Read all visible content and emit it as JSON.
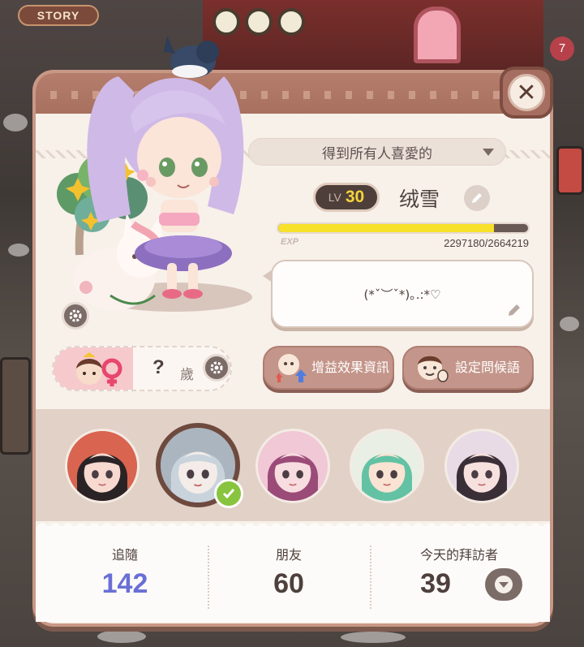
{
  "hud": {
    "story_label": "STORY",
    "notification_count": "7"
  },
  "profile": {
    "title_option": "得到所有人喜愛的",
    "level_prefix": "LV",
    "level": "30",
    "nickname": "绒雪",
    "exp_label": "EXP",
    "exp_text": "2297180/2664219",
    "exp_current": 2297180,
    "exp_max": 2664219,
    "greeting": "(*ˇ︶ˇ*)｡.:*♡",
    "age_value": "?",
    "age_unit": "歲"
  },
  "buttons": {
    "buff_effects": "增益效果資訊",
    "set_greeting": "設定問候語",
    "close_glyph": "✕"
  },
  "avatars": [
    {
      "name": "avatar-1",
      "selected": false,
      "hair": "#2a2326",
      "skin": "#f7d9cf",
      "bg": "#d9644f"
    },
    {
      "name": "avatar-2",
      "selected": true,
      "hair": "#c9d3dc",
      "skin": "#f3ece8",
      "bg": "#aab5bf"
    },
    {
      "name": "avatar-3",
      "selected": false,
      "hair": "#9b4b78",
      "skin": "#f8dde0",
      "bg": "#f1c8d6"
    },
    {
      "name": "avatar-4",
      "selected": false,
      "hair": "#63c2a4",
      "skin": "#f9e3d3",
      "bg": "#e9efe4"
    },
    {
      "name": "avatar-5",
      "selected": false,
      "hair": "#3b2f37",
      "skin": "#f7e1df",
      "bg": "#e8dbe6"
    }
  ],
  "stats": {
    "followers_label": "追隨",
    "followers": "142",
    "friends_label": "朋友",
    "friends": "60",
    "visitors_label": "今天的拜訪者",
    "visitors": "39"
  },
  "colors": {
    "accent_blue": "#6a6fd6",
    "exp_fill": "#f8e12a",
    "button": "#c4958a",
    "check": "#88c43f"
  }
}
